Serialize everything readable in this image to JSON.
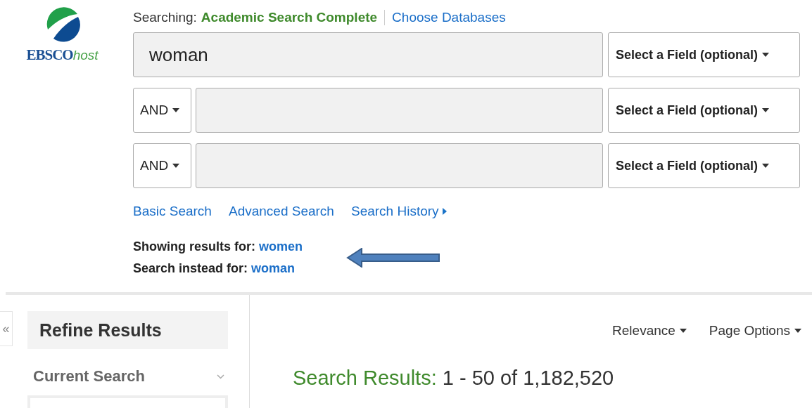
{
  "logo": {
    "name": "EBSCO",
    "suffix": "host"
  },
  "searching": {
    "label": "Searching:",
    "database": "Academic Search Complete",
    "link": "Choose Databases"
  },
  "search_rows": [
    {
      "kind": "first",
      "value": "woman",
      "field": "Select a Field (optional)"
    },
    {
      "kind": "bool",
      "operator": "AND",
      "field": "Select a Field (optional)"
    },
    {
      "kind": "bool",
      "operator": "AND",
      "field": "Select a Field (optional)"
    }
  ],
  "links": [
    {
      "label": "Basic Search",
      "caret": false
    },
    {
      "label": "Advanced Search",
      "caret": false
    },
    {
      "label": "Search History",
      "caret": true
    }
  ],
  "suggestions": [
    {
      "label": "Showing results for:",
      "term": "women"
    },
    {
      "label": "Search instead for:",
      "term": "woman"
    }
  ],
  "sidebar": {
    "collapse": "«",
    "title": "Refine Results",
    "section": "Current Search"
  },
  "sort_options": [
    {
      "label": "Relevance"
    },
    {
      "label": "Page Options"
    }
  ],
  "results": {
    "label": "Search Results:",
    "range": "1 - 50 of 1,182,520"
  }
}
